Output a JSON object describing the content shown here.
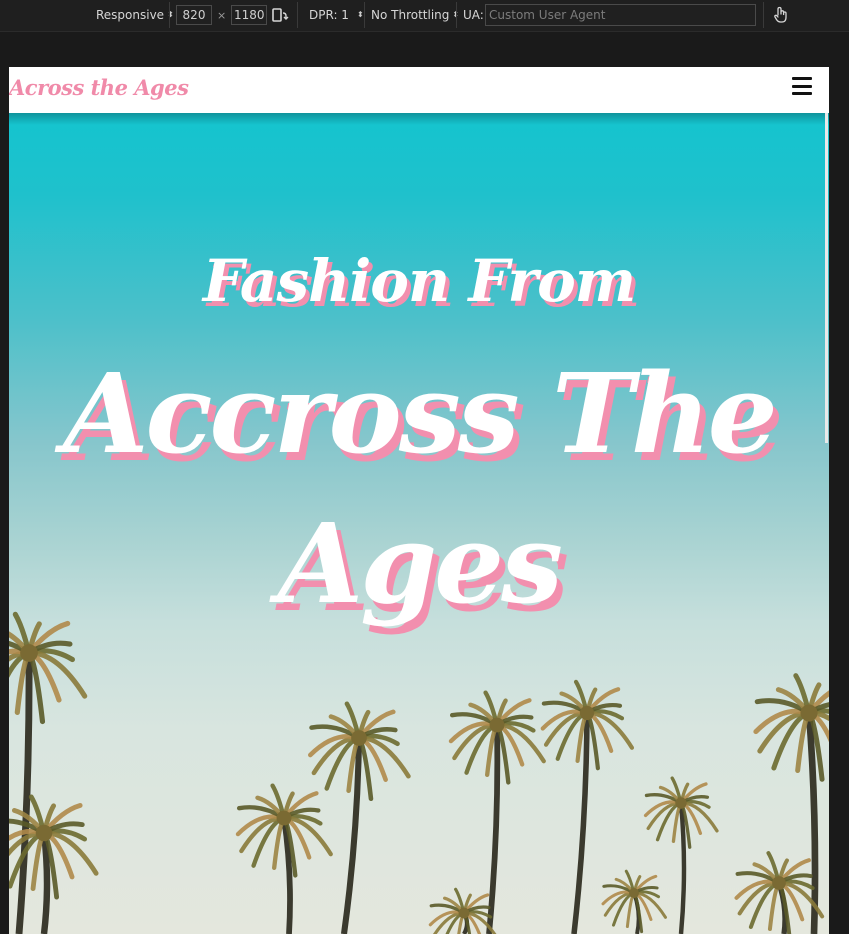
{
  "devtools": {
    "device_mode": "Responsive",
    "width": "820",
    "times": "×",
    "height": "1180",
    "dpr": "DPR: 1",
    "throttling": "No Throttling",
    "ua_label": "UA:",
    "ua_placeholder": "Custom User Agent"
  },
  "site": {
    "brand": "Across the Ages",
    "hero_line1": "Fashion From",
    "hero_line2": "Accross The Ages"
  },
  "colors": {
    "brand_pink": "#f08aa9",
    "sky_top": "#14c4cf",
    "sky_bottom": "#e4e7dd"
  }
}
